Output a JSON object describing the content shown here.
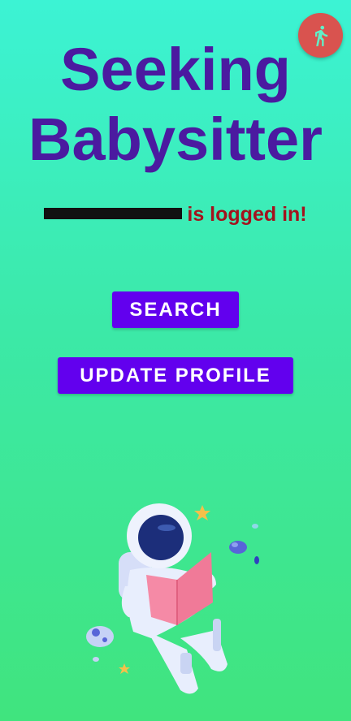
{
  "header": {
    "title_line1": "Seeking",
    "title_line2": "Babysitter",
    "logout_icon": "running-person-icon"
  },
  "status": {
    "suffix": "is logged in!"
  },
  "actions": {
    "search_label": "SEARCH",
    "update_profile_label": "UPDATE PROFILE"
  },
  "colors": {
    "title": "#4b1aa0",
    "status_text": "#a3121d",
    "button": "#6200ee",
    "logout": "#d9534f"
  }
}
